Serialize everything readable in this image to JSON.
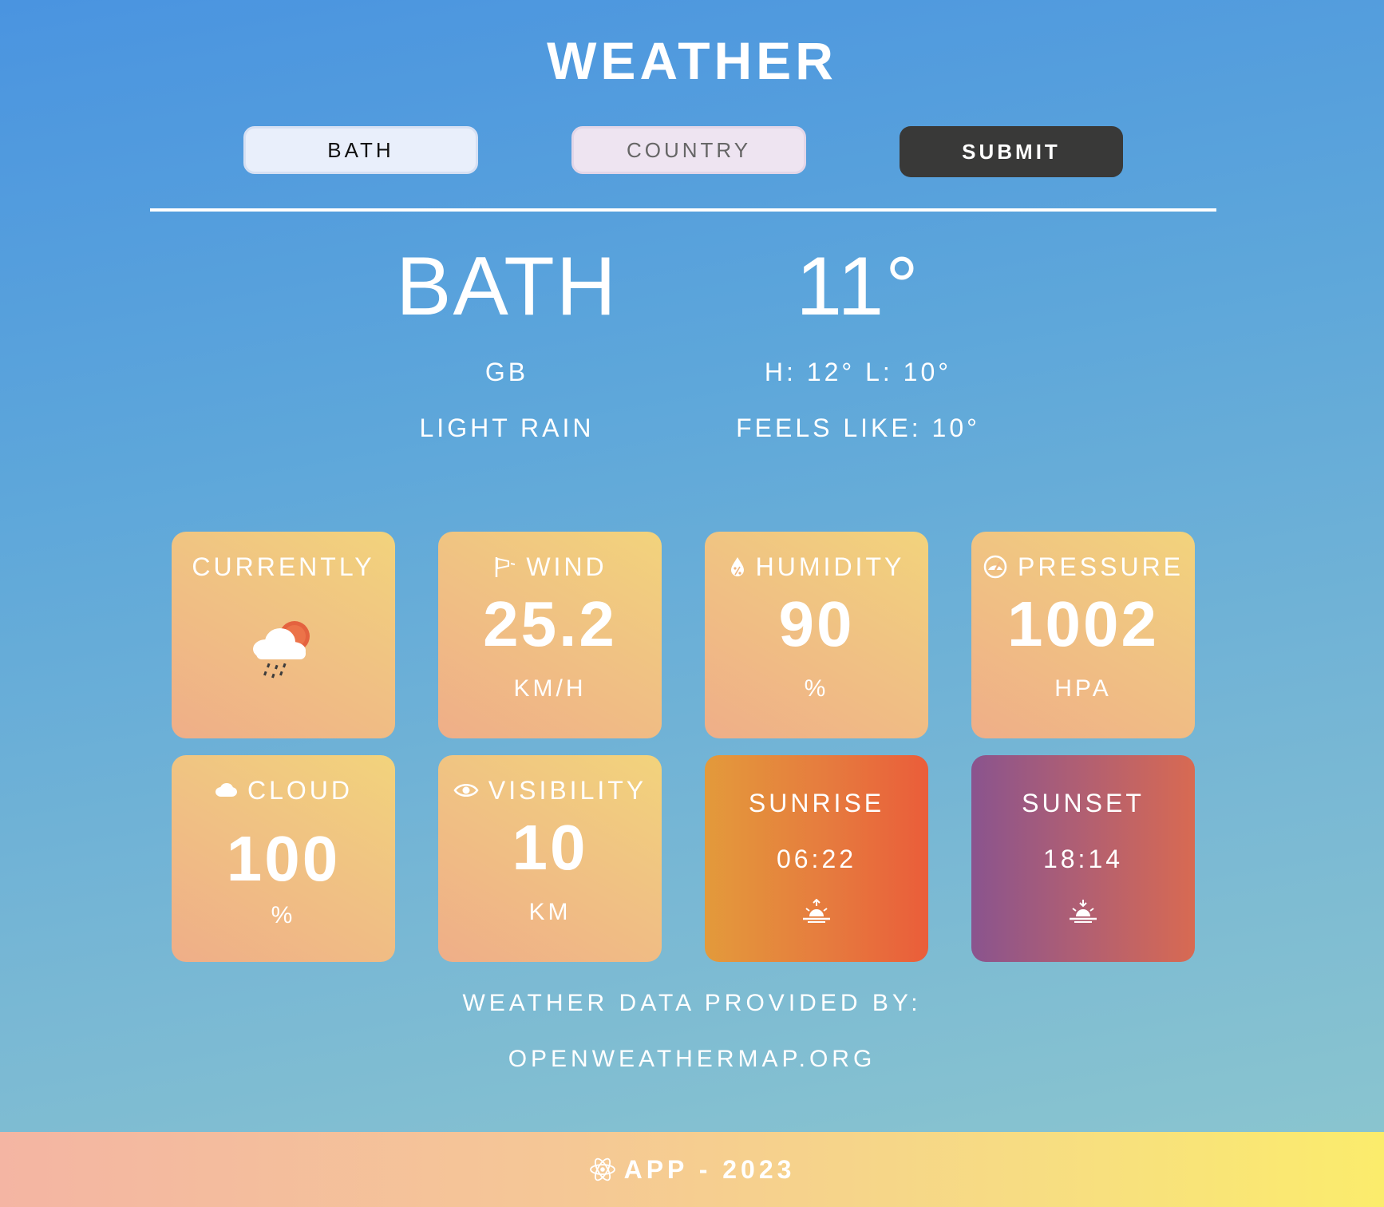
{
  "header": {
    "title": "WEATHER"
  },
  "search": {
    "city_value": "BATH",
    "country_placeholder": "COUNTRY",
    "submit_label": "SUBMIT"
  },
  "current": {
    "city": "BATH",
    "temperature": "11°",
    "country": "GB",
    "high_low": "H: 12° L: 10°",
    "description": "LIGHT RAIN",
    "feels_like": "FEELS LIKE: 10°"
  },
  "cards": {
    "currently": {
      "label": "CURRENTLY",
      "icon": "light-rain-sun-icon"
    },
    "wind": {
      "label": "WIND",
      "value": "25.2",
      "unit": "KM/H",
      "icon": "windsock-icon"
    },
    "humidity": {
      "label": "HUMIDITY",
      "value": "90",
      "unit": "%",
      "icon": "droplet-percent-icon"
    },
    "pressure": {
      "label": "PRESSURE",
      "value": "1002",
      "unit": "HPA",
      "icon": "gauge-icon"
    },
    "cloud": {
      "label": "CLOUD",
      "value": "100",
      "unit": "%",
      "icon": "cloud-icon"
    },
    "visibility": {
      "label": "VISIBILITY",
      "value": "10",
      "unit": "KM",
      "icon": "eye-icon"
    },
    "sunrise": {
      "label": "SUNRISE",
      "time": "06:22",
      "icon": "sunrise-icon"
    },
    "sunset": {
      "label": "SUNSET",
      "time": "18:14",
      "icon": "sunset-icon"
    }
  },
  "credits": {
    "line1": "WEATHER DATA PROVIDED BY:",
    "line2": "OPENWEATHERMAP.ORG"
  },
  "footer": {
    "text": "APP - 2023",
    "icon": "react-atom-icon"
  },
  "colors": {
    "background_top": "#4a94e0",
    "background_bottom": "#8dc7ce",
    "card": "#f0c283",
    "submit": "#393938",
    "sunrise_card": "#e67b3e",
    "sunset_card": "#8a548e",
    "footer": "#f7dd82"
  }
}
